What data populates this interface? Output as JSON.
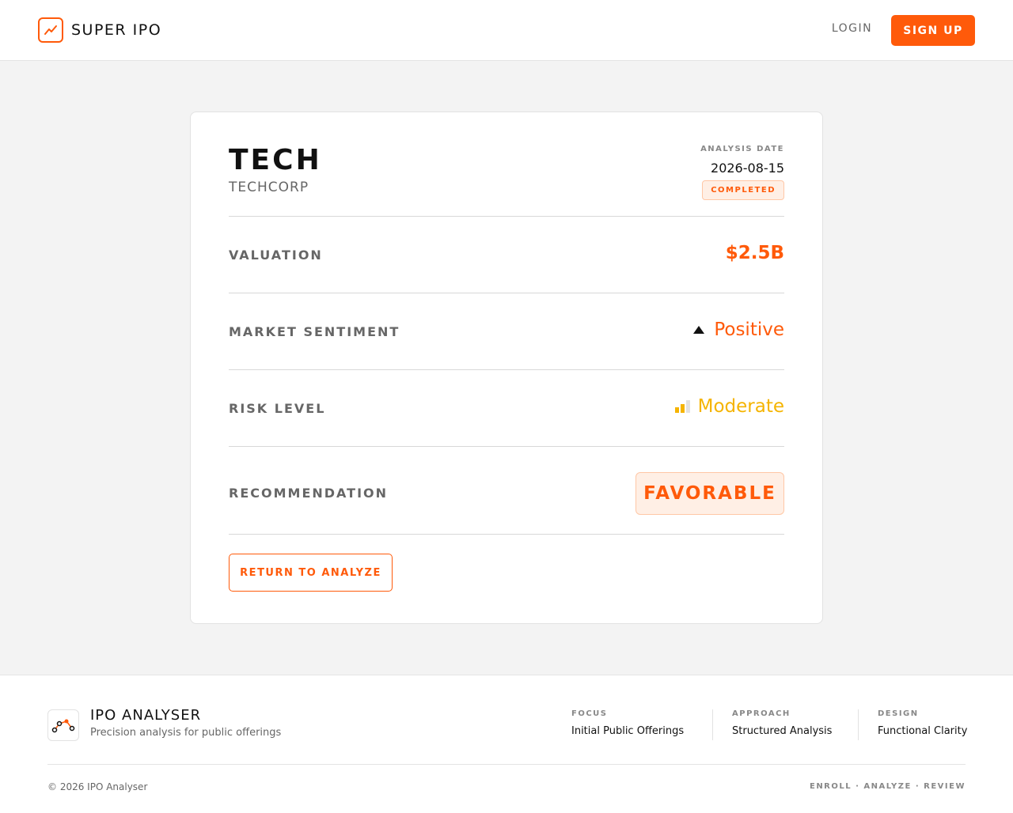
{
  "header": {
    "brand_name": "SUPER IPO",
    "login_label": "LOGIN",
    "signup_label": "SIGN UP"
  },
  "result": {
    "ticker": "TECH",
    "company": "TECHCORP",
    "analysis_date_label": "ANALYSIS DATE",
    "analysis_date": "2026-08-15",
    "status": "COMPLETED",
    "rows": [
      {
        "label": "VALUATION",
        "value": "$2.5B"
      },
      {
        "label": "MARKET SENTIMENT",
        "value": "Positive",
        "icon": "triangle-up-icon"
      },
      {
        "label": "RISK LEVEL",
        "value": "Moderate",
        "icon": "signal-bars-icon",
        "level": 2,
        "max_level": 3
      },
      {
        "label": "RECOMMENDATION",
        "value": "FAVORABLE"
      }
    ],
    "return_label": "RETURN TO ANALYZE"
  },
  "footer": {
    "title": "IPO ANALYSER",
    "tagline": "Precision analysis for public offerings",
    "columns": [
      {
        "label": "FOCUS",
        "value": "Initial Public Offerings"
      },
      {
        "label": "APPROACH",
        "value": "Structured Analysis"
      },
      {
        "label": "DESIGN",
        "value": "Functional Clarity"
      }
    ],
    "copyright": "© 2026 IPO Analyser",
    "links": "ENROLL · ANALYZE · REVIEW"
  },
  "colors": {
    "accent": "#ff5a0a",
    "risk_moderate": "#f5b400",
    "page_bg": "#f3f3f3"
  }
}
